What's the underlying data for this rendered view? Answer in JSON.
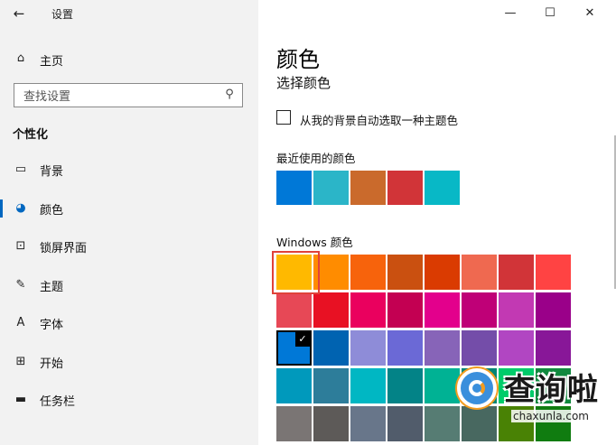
{
  "window": {
    "app_title": "设置",
    "controls": {
      "minimize": "—",
      "maximize": "☐",
      "close": "✕"
    }
  },
  "sidebar": {
    "home_label": "主页",
    "search_placeholder": "查找设置",
    "section_title": "个性化",
    "items": [
      {
        "label": "背景",
        "icon": "picture-icon",
        "glyph": "▭"
      },
      {
        "label": "颜色",
        "icon": "palette-icon",
        "glyph": "◕",
        "active": true
      },
      {
        "label": "锁屏界面",
        "icon": "lockscreen-icon",
        "glyph": "⊡"
      },
      {
        "label": "主题",
        "icon": "theme-icon",
        "glyph": "✎"
      },
      {
        "label": "字体",
        "icon": "font-icon",
        "glyph": "A"
      },
      {
        "label": "开始",
        "icon": "start-icon",
        "glyph": "⊞"
      },
      {
        "label": "任务栏",
        "icon": "taskbar-icon",
        "glyph": "▬"
      }
    ]
  },
  "main": {
    "title": "颜色",
    "subtitle": "选择颜色",
    "auto_accent_label": "从我的背景自动选取一种主题色",
    "recent_label": "最近使用的颜色",
    "recent_colors": [
      "#0078d7",
      "#2bb5c8",
      "#ca6a2c",
      "#d13438",
      "#08b8c6"
    ],
    "windows_colors_label": "Windows 颜色",
    "windows_colors": [
      [
        "#ffb900",
        "#ff8c00",
        "#f7630c",
        "#ca5010",
        "#da3b01",
        "#ef6950",
        "#d13438",
        "#ff4343"
      ],
      [
        "#e74856",
        "#e81123",
        "#ea005e",
        "#c30052",
        "#e3008c",
        "#bf0077",
        "#c239b3",
        "#9a0089"
      ],
      [
        "#0078d7",
        "#0063b1",
        "#8e8cd8",
        "#6b69d6",
        "#8764b8",
        "#744da9",
        "#b146c2",
        "#881798"
      ],
      [
        "#0099bc",
        "#2d7d9a",
        "#00b7c3",
        "#038387",
        "#00b294",
        "#018574",
        "#00cc6a",
        "#10893e"
      ],
      [
        "#7a7574",
        "#5d5a58",
        "#68768a",
        "#515c6b",
        "#567c73",
        "#486860",
        "#498205",
        "#107c10"
      ]
    ],
    "selected_check": "✓"
  },
  "watermark": {
    "text": "查询啦",
    "sub": "chaxunla.com"
  }
}
